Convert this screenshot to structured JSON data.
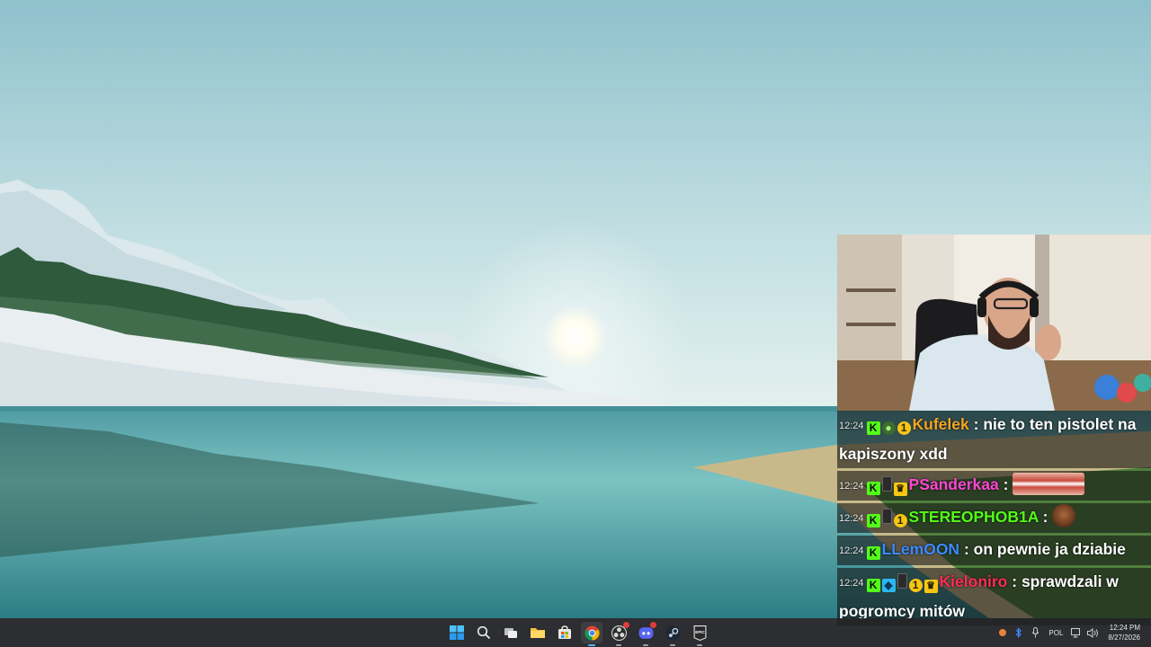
{
  "chat": {
    "messages": [
      {
        "time": "12:24",
        "badges": [
          "kick",
          "bomb",
          "sub"
        ],
        "user": "Kufelek",
        "user_color": "#f5a623",
        "separator": ":",
        "text": "nie to ten pistolet na kapiszony xdd",
        "emote": ""
      },
      {
        "time": "12:24",
        "badges": [
          "kick",
          "phone",
          "crown"
        ],
        "user": "PSanderkaa",
        "user_color": "#ff47d1",
        "separator": ":",
        "text": "",
        "emote": "mouth-emote"
      },
      {
        "time": "12:24",
        "badges": [
          "kick",
          "phone",
          "sub"
        ],
        "user": "STEREOPHOB1A",
        "user_color": "#53fc18",
        "separator": ":",
        "text": "",
        "emote": "face-emote"
      },
      {
        "time": "12:24",
        "badges": [
          "kick"
        ],
        "user": "LLemOON",
        "user_color": "#3b8bff",
        "separator": ":",
        "text": "on pewnie ja dziabie",
        "emote": ""
      },
      {
        "time": "12:24",
        "badges": [
          "kick",
          "cube",
          "phone",
          "sub",
          "crown"
        ],
        "user": "Kieloniro",
        "user_color": "#ff2d55",
        "separator": ":",
        "text": "sprawdzali w pogromcy mitów",
        "emote": ""
      }
    ]
  },
  "badge_glyphs": {
    "kick": "K",
    "bomb": "●",
    "sub": "1",
    "phone": "",
    "crown": "♛",
    "cube": "◆"
  },
  "taskbar": {
    "apps": [
      {
        "name": "start-button",
        "icon": "windows-logo-icon",
        "running": false,
        "active": false
      },
      {
        "name": "search-button",
        "icon": "search-icon",
        "running": false,
        "active": false
      },
      {
        "name": "task-view-button",
        "icon": "task-view-icon",
        "running": false,
        "active": false
      },
      {
        "name": "file-explorer-button",
        "icon": "folder-icon",
        "running": false,
        "active": false
      },
      {
        "name": "store-button",
        "icon": "store-icon",
        "running": false,
        "active": false
      },
      {
        "name": "chrome-button",
        "icon": "chrome-icon",
        "running": true,
        "active": true
      },
      {
        "name": "obs-button",
        "icon": "obs-icon",
        "running": true,
        "active": false
      },
      {
        "name": "discord-button",
        "icon": "discord-icon",
        "running": true,
        "active": false
      },
      {
        "name": "steam-button",
        "icon": "steam-icon",
        "running": true,
        "active": false
      },
      {
        "name": "epic-button",
        "icon": "epic-games-icon",
        "running": true,
        "active": false
      }
    ],
    "epic_label": "EPIC",
    "language": "POL",
    "time": "12:24 PM",
    "date": "8/27/2026"
  }
}
